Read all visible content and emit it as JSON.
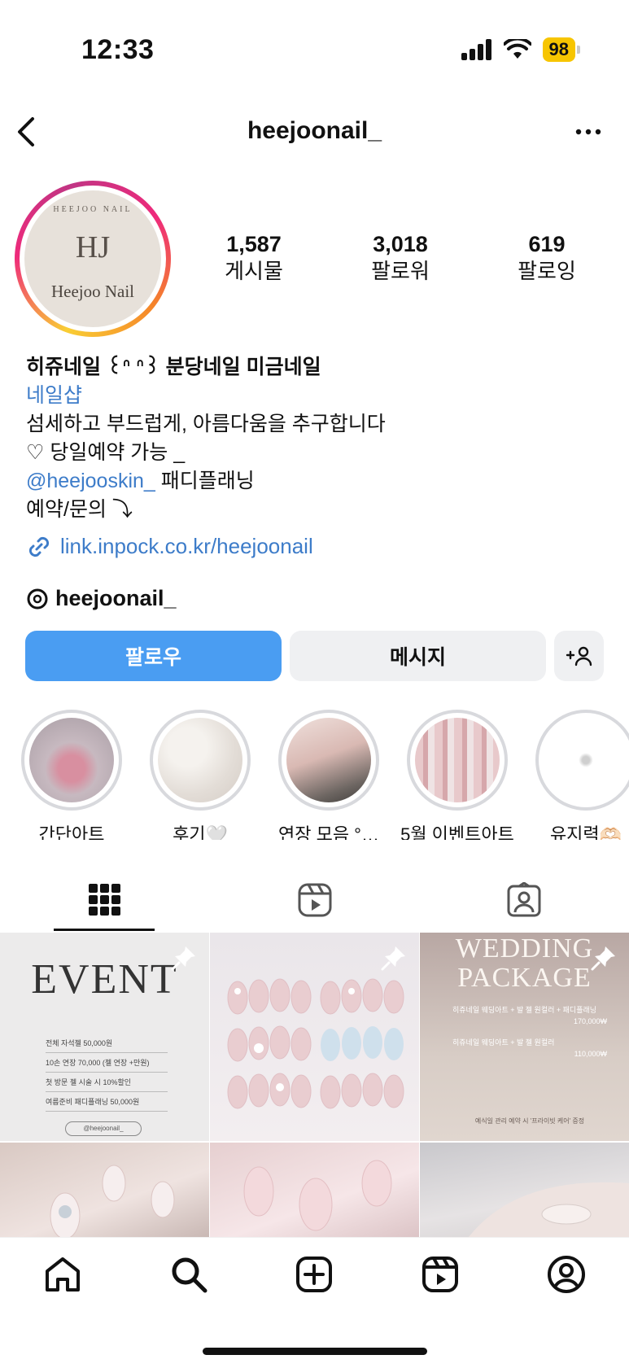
{
  "status_bar": {
    "time": "12:33",
    "battery": "98"
  },
  "header": {
    "username": "heejoonail_"
  },
  "avatar": {
    "monogram": "HJ",
    "arc_text": "HEEJOO NAIL",
    "name": "Heejoo Nail"
  },
  "stats": [
    {
      "value": "1,587",
      "label": "게시물"
    },
    {
      "value": "3,018",
      "label": "팔로워"
    },
    {
      "value": "619",
      "label": "팔로잉"
    }
  ],
  "bio": {
    "name": "히쥬네일 ꒰ᐢ ᐢ꒱ 분당네일 미금네일",
    "category": "네일샵",
    "line1": "섬세하고 부드럽게, 아름다움을 추구합니다",
    "line2": "♡ 당일예약 가능 _",
    "mention": "@heejooskin_",
    "mention_suffix": " 패디플래닝",
    "line4": "예약/문의 ⤵",
    "link": "link.inpock.co.kr/heejoonail"
  },
  "threads": {
    "handle": "heejoonail_"
  },
  "actions": {
    "follow": "팔로우",
    "message": "메시지"
  },
  "highlights": [
    {
      "label": "간단아트"
    },
    {
      "label": "후기🤍"
    },
    {
      "label": "연장 모음 °…"
    },
    {
      "label": "5월 이벤트아트"
    },
    {
      "label": "유지력🫶🏻"
    }
  ],
  "posts": {
    "event": {
      "title": "EVENT",
      "rows": [
        "전체 자석젤 50,000원",
        "10손 연장 70,000 (젤 연장 +만원)",
        "첫 방문 젤 시술 시 10%할인",
        "여름준비 패디플래닝 50,000원"
      ],
      "tag": "@heejoonail_"
    },
    "wedding": {
      "title_line1": "WEDDING",
      "title_line2": "PACKAGE",
      "line1": "히쥬네일 웨딩아트 + 발 젤 원컬러 + 패디플래닝",
      "price1": "170,000₩",
      "line2": "히쥬네일 웨딩아트 + 발 젤 원컬러",
      "price2": "110,000₩",
      "note": "예식일 관리 예약 시 '프라이빗 케어' 증정"
    }
  },
  "colors": {
    "follow": "#4a9df2",
    "link": "#3d7cc9",
    "battery": "#f7c500"
  }
}
